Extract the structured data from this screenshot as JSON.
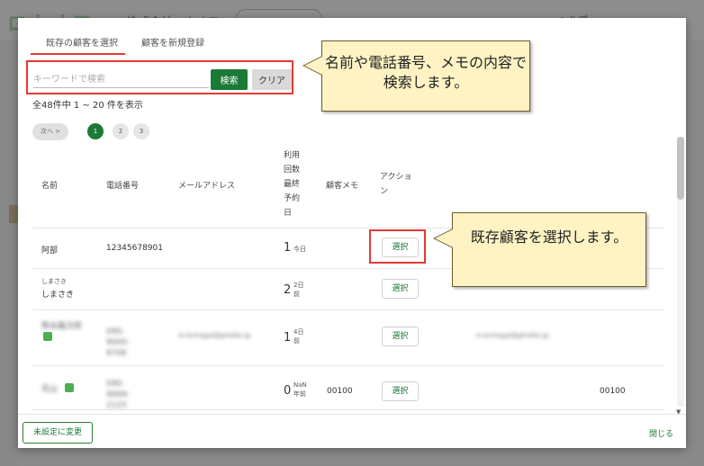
{
  "background": {
    "logo_text": "ロカオフ",
    "company": "株式会社ロカオフ",
    "search_placeholder": "検索",
    "right_text": "ヘルプ"
  },
  "modal": {
    "tabs": [
      {
        "label": "既存の顧客を選択",
        "active": true
      },
      {
        "label": "顧客を新規登録",
        "active": false
      }
    ],
    "search": {
      "placeholder": "キーワードで検索",
      "value": "",
      "search_label": "検索",
      "clear_label": "クリア"
    },
    "result_count": "全48件中 1 ~ 20 件を表示",
    "pagination": {
      "next_label": "次へ >",
      "pages": [
        "1",
        "2",
        "3"
      ],
      "current": "1"
    },
    "table": {
      "headers": {
        "name": "名前",
        "phone": "電話番号",
        "email": "メールアドレス",
        "usage": "利用回数最終予約日",
        "memo": "顧客メモ",
        "action": "アクション"
      },
      "rows": [
        {
          "kana": "",
          "name": "阿部",
          "phone": "12345678901",
          "email": "",
          "count": "1",
          "last": "今日",
          "memo": "",
          "action": "選択",
          "extra": ""
        },
        {
          "kana": "しまさき",
          "name": "しまさき",
          "phone": "",
          "email": "",
          "count": "2",
          "last": "2日前",
          "memo": "",
          "action": "選択",
          "extra": ""
        },
        {
          "kana": "",
          "name": "熊谷義次郎",
          "phone": "090-9000-8706",
          "email": "m.kumagai@gmobiz.jp",
          "count": "1",
          "last": "4日前",
          "memo": "",
          "action": "選択",
          "extra": "m.kumagai@gmobiz.jp"
        },
        {
          "kana": "",
          "name": "花山",
          "phone": "090-9669-2125",
          "email": "",
          "count": "0",
          "last": "NaN年前",
          "memo": "00100",
          "action": "選択",
          "extra": "00100"
        }
      ]
    },
    "footer": {
      "unset_label": "未設定に変更",
      "close_label": "閉じる"
    }
  },
  "callouts": {
    "search_tip": "名前や電話番号、メモの内容で検索します。",
    "select_tip": "既存顧客を選択します。"
  },
  "colors": {
    "accent": "#1b7a36",
    "highlight": "#e53935",
    "callout_bg": "#fff3c4"
  }
}
